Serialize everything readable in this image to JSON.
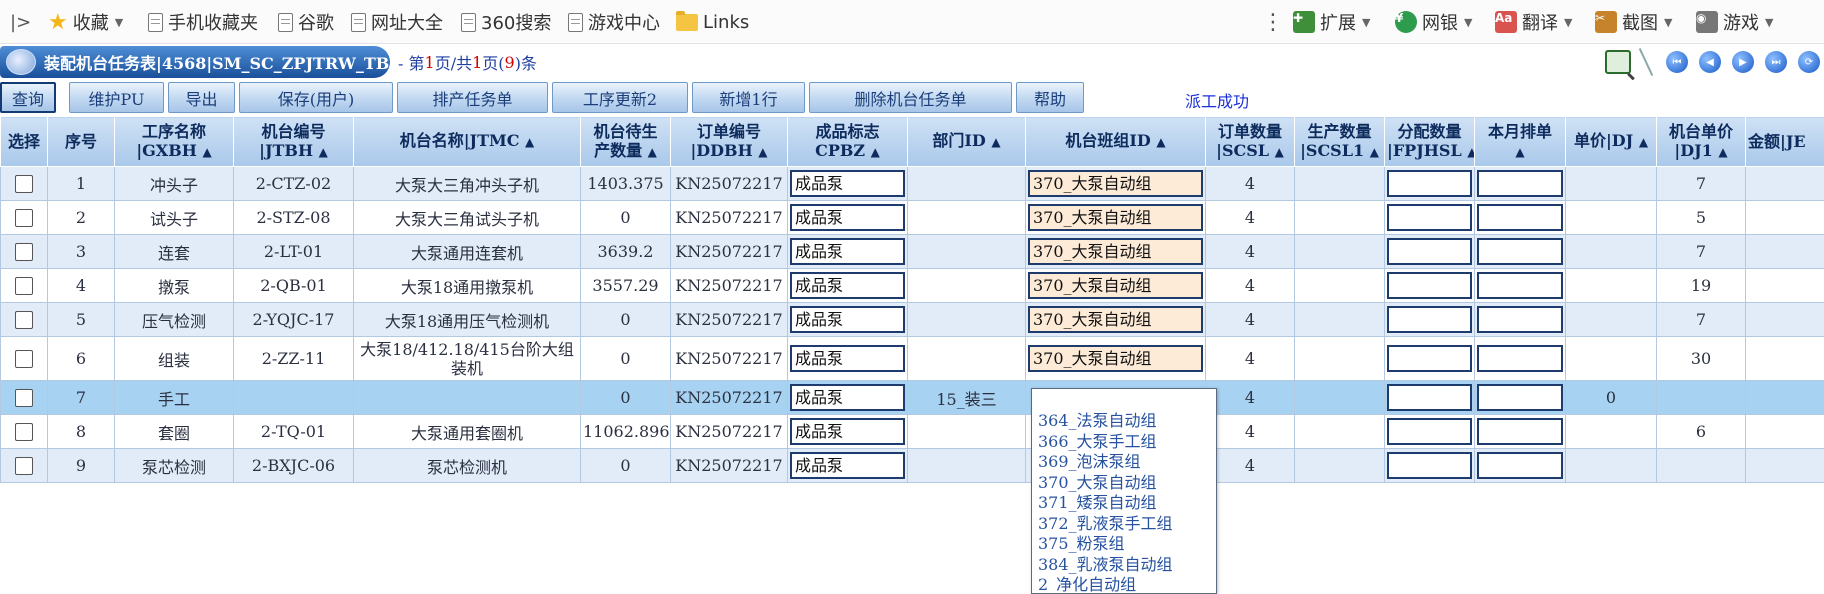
{
  "browser": {
    "bookmarks": [
      {
        "id": "favorites",
        "label": "收藏",
        "icon": "star-icon",
        "has_dropdown": true
      },
      {
        "id": "mobile-favorites",
        "label": "手机收藏夹",
        "icon": "page-icon"
      },
      {
        "id": "google",
        "label": "谷歌",
        "icon": "page-icon"
      },
      {
        "id": "url-directory",
        "label": "网址大全",
        "icon": "page-icon"
      },
      {
        "id": "360-search",
        "label": "360搜索",
        "icon": "page-icon"
      },
      {
        "id": "game-center",
        "label": "游戏中心",
        "icon": "page-icon"
      },
      {
        "id": "links",
        "label": "Links",
        "icon": "folder-icon"
      }
    ],
    "right_tools": [
      {
        "id": "extensions",
        "label": "扩展",
        "icon": "extensions-icon",
        "icon_color": "#3f8f3a"
      },
      {
        "id": "netbank",
        "label": "网银",
        "icon": "netbank-icon",
        "icon_color": "#2e9c4d"
      },
      {
        "id": "translate",
        "label": "翻译",
        "icon": "translate-icon",
        "icon_color": "#d9534f"
      },
      {
        "id": "screenshot",
        "label": "截图",
        "icon": "scissors-icon",
        "icon_color": "#c7832b"
      },
      {
        "id": "games",
        "label": "游戏",
        "icon": "gamepad-icon",
        "icon_color": "#777777"
      }
    ]
  },
  "app": {
    "title": "装配机台任务表|4568|SM_SC_ZPJTRW_TB",
    "pager": {
      "prefix": "- 第",
      "current_page": "1",
      "mid1": "页/共",
      "total_pages": "1",
      "mid2": "页(",
      "total_rows": "9",
      "suffix": ")条"
    }
  },
  "toolbar": {
    "buttons": [
      {
        "id": "query",
        "label": "查询",
        "active": true
      },
      {
        "id": "maintain-pu",
        "label": "维护PU"
      },
      {
        "id": "export",
        "label": "导出"
      },
      {
        "id": "save-user",
        "label": "保存(用户)"
      },
      {
        "id": "schedule-task",
        "label": "排产任务单"
      },
      {
        "id": "process-update2",
        "label": "工序更新2"
      },
      {
        "id": "add-row",
        "label": "新增1行"
      },
      {
        "id": "delete-machine-task",
        "label": "删除机台任务单"
      },
      {
        "id": "help",
        "label": "帮助"
      }
    ],
    "status": "派工成功"
  },
  "grid": {
    "columns": [
      {
        "id": "select",
        "label": "选择"
      },
      {
        "id": "seq",
        "label": "序号"
      },
      {
        "id": "gxbh",
        "line1": "工序名称",
        "line2": "|GXBH"
      },
      {
        "id": "jtbh",
        "line1": "机台编号",
        "line2": "|JTBH"
      },
      {
        "id": "jtmc",
        "label": "机台名称|JTMC"
      },
      {
        "id": "pending",
        "line1": "机台待生",
        "line2": "产数量"
      },
      {
        "id": "ddbh",
        "line1": "订单编号",
        "line2": "|DDBH"
      },
      {
        "id": "cpbz",
        "line1": "成品标志",
        "line2": "CPBZ"
      },
      {
        "id": "dept",
        "label": "部门ID"
      },
      {
        "id": "team",
        "label": "机台班组ID"
      },
      {
        "id": "scsl",
        "line1": "订单数量",
        "line2": "|SCSL"
      },
      {
        "id": "scsl1",
        "line1": "生产数量",
        "line2": "|SCSL1"
      },
      {
        "id": "fpjhsl",
        "line1": "分配数量",
        "line2": "|FPJHSL"
      },
      {
        "id": "monthly",
        "line1": "本月排单",
        "line2": ""
      },
      {
        "id": "dj",
        "label": "单价|DJ"
      },
      {
        "id": "dj1",
        "line1": "机台单价",
        "line2": "|DJ1"
      },
      {
        "id": "je",
        "label": "金额|JE"
      }
    ],
    "rows": [
      {
        "seq": "1",
        "process": "冲头子",
        "machine_no": "2-CTZ-02",
        "machine_name": "大泵大三角冲头子机",
        "pending_qty": "1403.375",
        "order_no": "KN25072217",
        "product_flag": "成品泵",
        "dept": "",
        "team": "370_大泵自动组",
        "order_qty": "4",
        "prod_qty": "",
        "price": "",
        "machine_price": "7",
        "amount": ""
      },
      {
        "seq": "2",
        "process": "试头子",
        "machine_no": "2-STZ-08",
        "machine_name": "大泵大三角试头子机",
        "pending_qty": "0",
        "order_no": "KN25072217",
        "product_flag": "成品泵",
        "dept": "",
        "team": "370_大泵自动组",
        "order_qty": "4",
        "prod_qty": "",
        "price": "",
        "machine_price": "5",
        "amount": ""
      },
      {
        "seq": "3",
        "process": "连套",
        "machine_no": "2-LT-01",
        "machine_name": "大泵通用连套机",
        "pending_qty": "3639.2",
        "order_no": "KN25072217",
        "product_flag": "成品泵",
        "dept": "",
        "team": "370_大泵自动组",
        "order_qty": "4",
        "prod_qty": "",
        "price": "",
        "machine_price": "7",
        "amount": ""
      },
      {
        "seq": "4",
        "process": "撴泵",
        "machine_no": "2-QB-01",
        "machine_name": "大泵18通用撴泵机",
        "pending_qty": "3557.29",
        "order_no": "KN25072217",
        "product_flag": "成品泵",
        "dept": "",
        "team": "370_大泵自动组",
        "order_qty": "4",
        "prod_qty": "",
        "price": "",
        "machine_price": "19",
        "amount": ""
      },
      {
        "seq": "5",
        "process": "压气检测",
        "machine_no": "2-YQJC-17",
        "machine_name": "大泵18通用压气检测机",
        "pending_qty": "0",
        "order_no": "KN25072217",
        "product_flag": "成品泵",
        "dept": "",
        "team": "370_大泵自动组",
        "order_qty": "4",
        "prod_qty": "",
        "price": "",
        "machine_price": "7",
        "amount": ""
      },
      {
        "seq": "6",
        "process": "组装",
        "machine_no": "2-ZZ-11",
        "machine_name": "大泵18/412.18/415台阶大组装机",
        "pending_qty": "0",
        "order_no": "KN25072217",
        "product_flag": "成品泵",
        "dept": "",
        "team": "370_大泵自动组",
        "order_qty": "4",
        "prod_qty": "",
        "price": "",
        "machine_price": "30",
        "amount": ""
      },
      {
        "seq": "7",
        "process": "手工",
        "machine_no": "",
        "machine_name": "",
        "pending_qty": "0",
        "order_no": "KN25072217",
        "product_flag": "成品泵",
        "dept": "15_装三",
        "team": "",
        "order_qty": "4",
        "prod_qty": "",
        "price": "0",
        "machine_price": "",
        "amount": ""
      },
      {
        "seq": "8",
        "process": "套圈",
        "machine_no": "2-TQ-01",
        "machine_name": "大泵通用套圈机",
        "pending_qty": "11062.896",
        "order_no": "KN25072217",
        "product_flag": "成品泵",
        "dept": "",
        "team": "",
        "order_qty": "4",
        "prod_qty": "",
        "price": "",
        "machine_price": "6",
        "amount": ""
      },
      {
        "seq": "9",
        "process": "泵芯检测",
        "machine_no": "2-BXJC-06",
        "machine_name": "泵芯检测机",
        "pending_qty": "0",
        "order_no": "KN25072217",
        "product_flag": "成品泵",
        "dept": "",
        "team": "",
        "order_qty": "4",
        "prod_qty": "",
        "price": "",
        "machine_price": "",
        "amount": ""
      }
    ]
  },
  "team_dropdown": {
    "options": [
      "364_法泵自动组",
      "366_大泵手工组",
      "369_泡沫泵组",
      "370_大泵自动组",
      "371_矮泵自动组",
      "372_乳液泵手工组",
      "375_粉泵组",
      "384_乳液泵自动组",
      "2_净化自动组"
    ]
  }
}
